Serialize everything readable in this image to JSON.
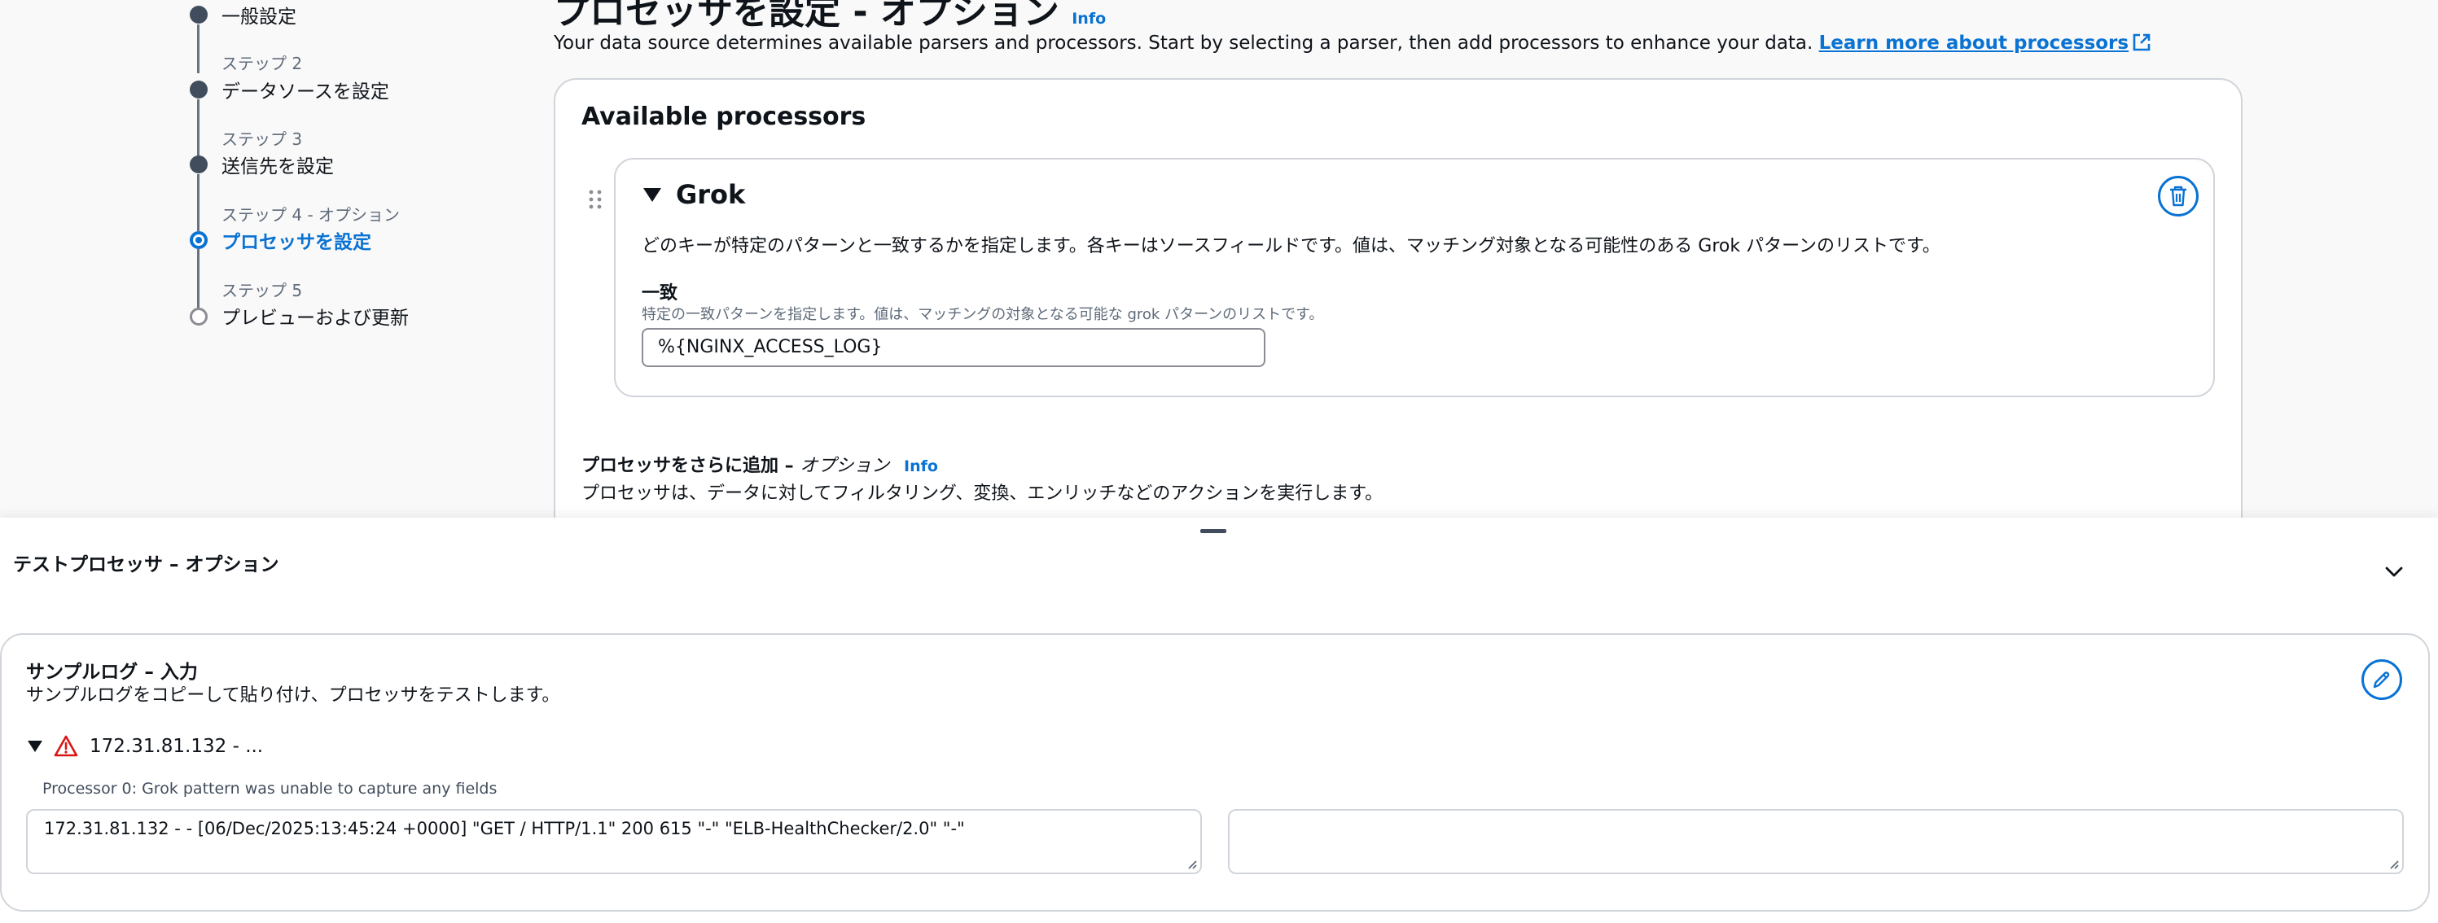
{
  "stepper": {
    "step1": {
      "name": "一般設定"
    },
    "step2": {
      "small": "ステップ 2",
      "name": "データソースを設定"
    },
    "step3": {
      "small": "ステップ 3",
      "name": "送信先を設定"
    },
    "step4": {
      "small": "ステップ 4 - オプション",
      "name": "プロセッサを設定"
    },
    "step5": {
      "small": "ステップ 5",
      "name": "プレビューおよび更新"
    }
  },
  "header": {
    "title": "プロセッサを設定 - オプション",
    "info": "Info",
    "description": "Your data source determines available parsers and processors. Start by selecting a parser, then add processors to enhance your data.",
    "learn_more": "Learn more about processors"
  },
  "available": {
    "title": "Available processors",
    "processor": {
      "name": "Grok",
      "description": "どのキーが特定のパターンと一致するかを指定します。各キーはソースフィールドです。値は、マッチング対象となる可能性のある Grok パターンのリストです。",
      "field_label": "一致",
      "field_help": "特定の一致パターンを指定します。値は、マッチングの対象となる可能な grok パターンのリストです。",
      "field_value": "%{NGINX_ACCESS_LOG}"
    },
    "add_more": {
      "title": "プロセッサをさらに追加 –",
      "title_suffix": "オプション",
      "info": "Info",
      "description": "プロセッサは、データに対してフィルタリング、変換、エンリッチなどのアクションを実行します。"
    }
  },
  "test_panel": {
    "title": "テストプロセッサ – オプション",
    "sample": {
      "title": "サンプルログ – 入力",
      "description": "サンプルログをコピーして貼り付け、プロセッサをテストします。",
      "log_summary": "172.31.81.132 - ...",
      "error": "Processor 0: Grok pattern was unable to capture any fields",
      "input_value": "172.31.81.132 - - [06/Dec/2025:13:45:24 +0000] \"GET / HTTP/1.1\" 200 615 \"-\" \"ELB-HealthChecker/2.0\" \"-\"",
      "output_value": ""
    }
  },
  "colors": {
    "accent": "#0972d3",
    "error": "#d91515",
    "text": "#0f141a",
    "border": "#d1d5db"
  }
}
